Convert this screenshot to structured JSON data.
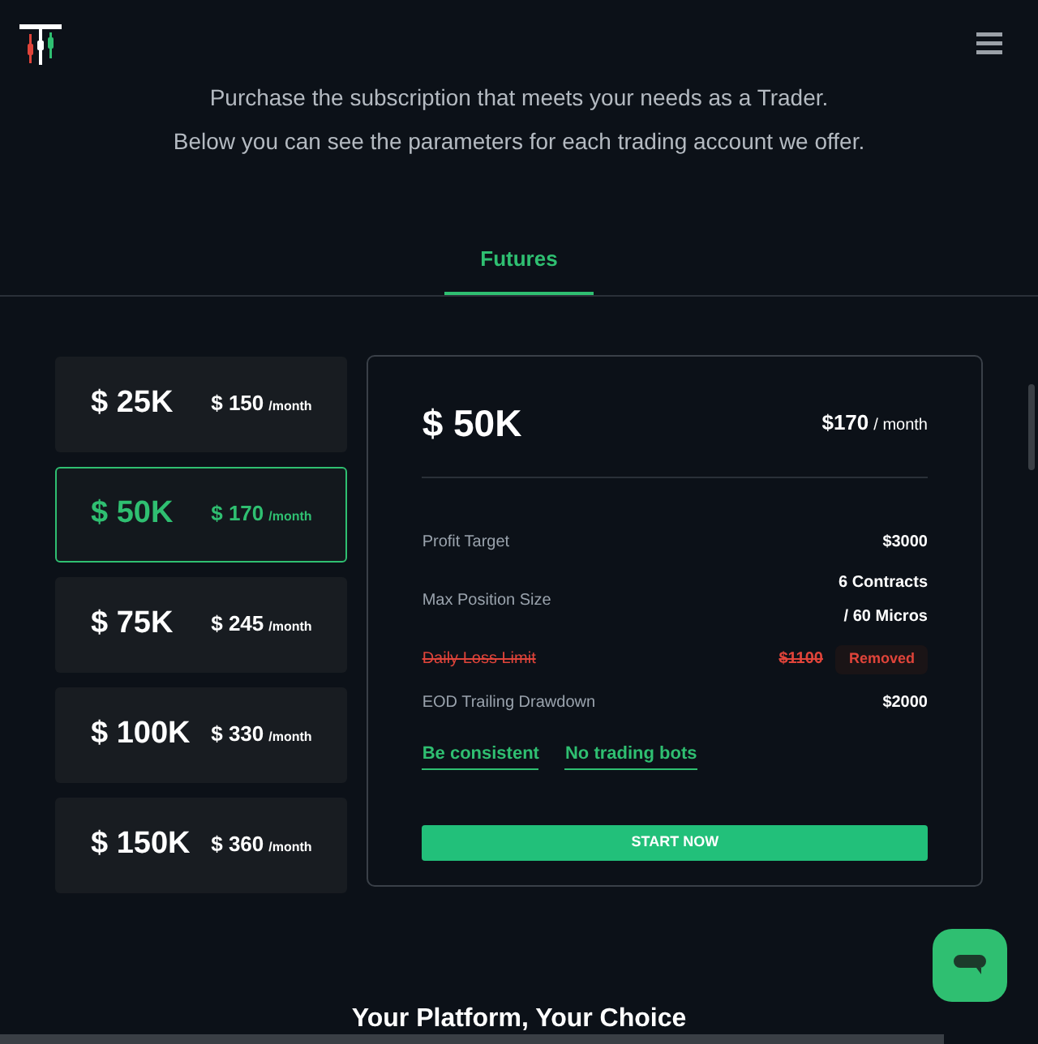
{
  "intro": [
    "Purchase the subscription that meets your needs as a Trader.",
    "Below you can see the parameters for each trading account we offer."
  ],
  "tabs": [
    {
      "label": "Futures",
      "selected": true
    }
  ],
  "plans": [
    {
      "size": "$ 25K",
      "price": "$ 150",
      "unit": "/month",
      "selected": false
    },
    {
      "size": "$ 50K",
      "price": "$ 170",
      "unit": "/month",
      "selected": true
    },
    {
      "size": "$ 75K",
      "price": "$ 245",
      "unit": "/month",
      "selected": false
    },
    {
      "size": "$ 100K",
      "price": "$ 330",
      "unit": "/month",
      "selected": false
    },
    {
      "size": "$ 150K",
      "price": "$ 360",
      "unit": "/month",
      "selected": false
    }
  ],
  "detail": {
    "size": "$ 50K",
    "price": "$170",
    "unit": "/ month",
    "rows": [
      {
        "kind": "normal",
        "label": "Profit Target",
        "values": [
          "$3000"
        ]
      },
      {
        "kind": "normal",
        "label": "Max Position Size",
        "values": [
          "6 Contracts",
          "/ 60 Micros"
        ]
      },
      {
        "kind": "removed",
        "label": "Daily Loss Limit",
        "values": [
          "$1100"
        ],
        "badge": "Removed"
      },
      {
        "kind": "normal",
        "label": "EOD Trailing Drawdown",
        "values": [
          "$2000"
        ]
      }
    ],
    "rules": [
      "Be consistent",
      "No trading bots"
    ],
    "button": "START NOW"
  },
  "next_heading": "Your Platform, Your Choice"
}
